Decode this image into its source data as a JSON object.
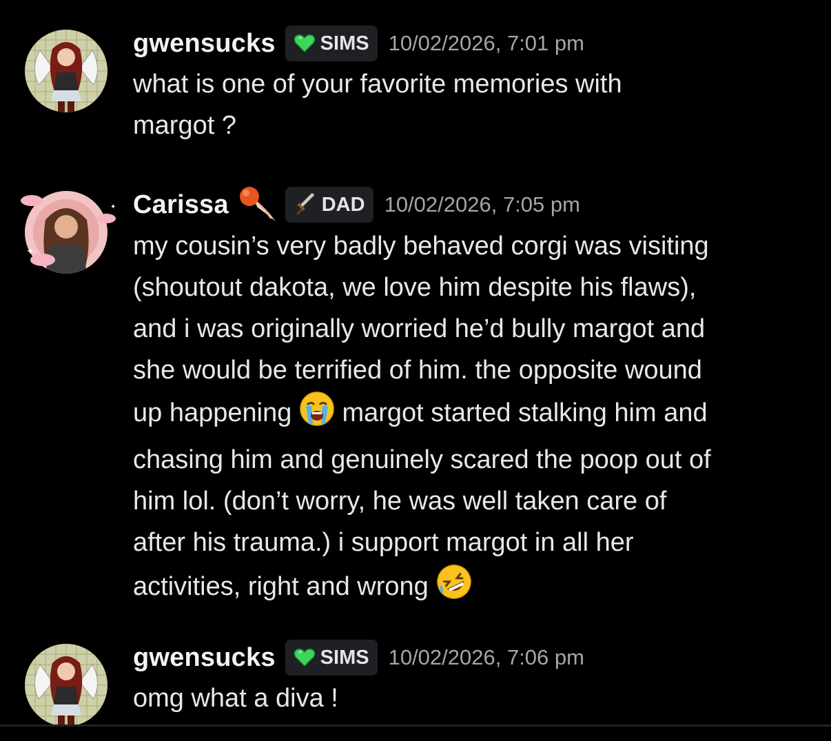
{
  "messages": [
    {
      "author": "gwensucks",
      "role_tag": "SIMS",
      "role_icon": "green-heart-icon",
      "timestamp": "10/02/2026, 7:01 pm",
      "lines": [
        "what is one of your favorite memories with",
        "margot ?"
      ]
    },
    {
      "author": "Carissa",
      "author_badge_icon": "comet-icon",
      "role_tag": "DAD",
      "role_icon": "sword-icon",
      "timestamp": "10/02/2026, 7:05 pm",
      "lines": [
        "my cousin’s very badly behaved corgi was visiting",
        "(shoutout dakota, we love him despite his flaws),",
        "and i was originally worried he’d bully margot and",
        "she would be terrified of him. the opposite wound",
        "up happening",
        "margot started stalking him and",
        "chasing him and genuinely scared the poop out of",
        "him lol. (don’t worry, he was well taken care of",
        "after his trauma.) i support margot in all her",
        "activities, right and wrong"
      ],
      "emojis": [
        "loudly-crying-face-emoji",
        "rolling-on-floor-laughing-emoji"
      ]
    },
    {
      "author": "gwensucks",
      "role_tag": "SIMS",
      "role_icon": "green-heart-icon",
      "timestamp": "10/02/2026, 7:06 pm",
      "lines": [
        "omg what a diva !"
      ]
    }
  ],
  "colors": {
    "background": "#000000",
    "username": "#f2f3f5",
    "message_text": "#e8e8ea",
    "timestamp": "#a3a6ad",
    "role_tag_bg": "#1f2023",
    "heart_green": "#3ed65a"
  }
}
